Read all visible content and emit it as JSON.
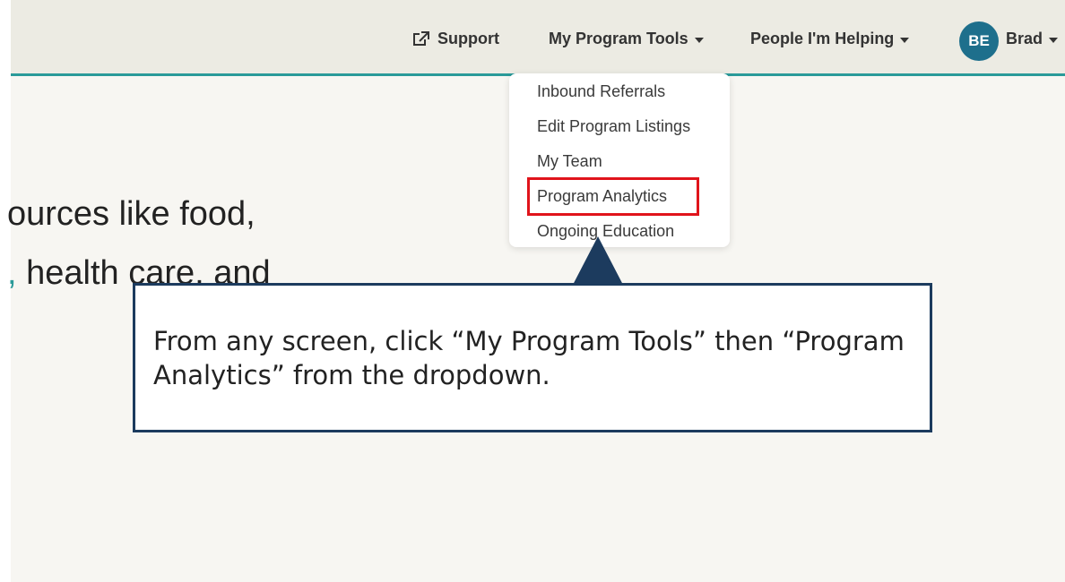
{
  "header": {
    "support_label": "Support",
    "support_icon": "external-link-icon",
    "program_tools_label": "My Program Tools",
    "people_helping_label": "People I'm Helping",
    "user": {
      "initials": "BE",
      "name": "Brad",
      "avatar_color": "#1e6f8c"
    },
    "accent_color": "#2a9a99"
  },
  "hero": {
    "line1": "ources like food,",
    "line2": "health care, and"
  },
  "dropdown": {
    "items": [
      {
        "label": "Inbound Referrals"
      },
      {
        "label": "Edit Program Listings"
      },
      {
        "label": "My Team"
      },
      {
        "label": "Program Analytics",
        "highlighted": true
      },
      {
        "label": "Ongoing Education"
      }
    ],
    "highlight_color": "#e0141b"
  },
  "callout": {
    "text": "From any screen, click “My Program Tools” then “Program Analytics” from the dropdown.",
    "border_color": "#1c3b5e"
  }
}
